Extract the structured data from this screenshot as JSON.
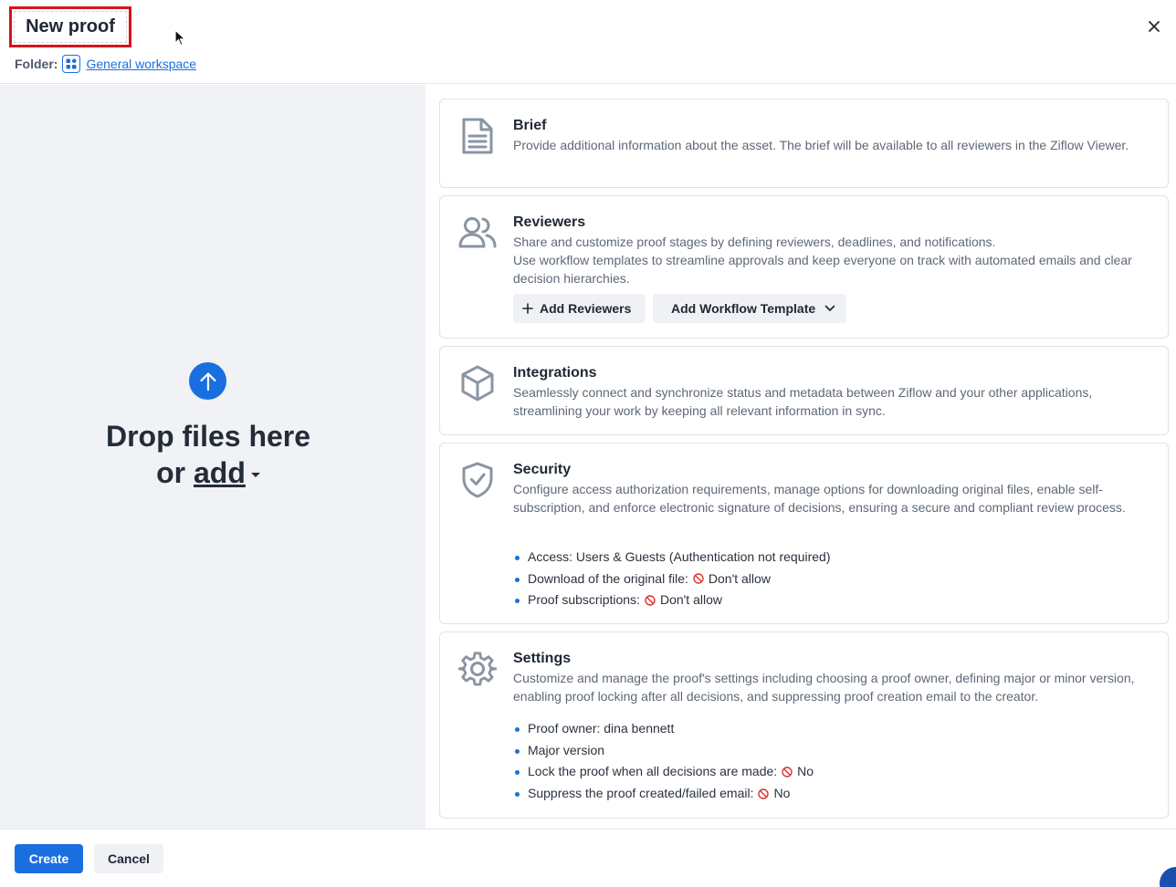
{
  "header": {
    "title": "New proof",
    "folder_label": "Folder:",
    "folder_link": "General workspace",
    "folder_icon": "grid-folder-icon",
    "close_icon": "close-icon"
  },
  "drop_zone": {
    "line1": "Drop files here",
    "line2_prefix": "or ",
    "add_link": "add",
    "upload_icon": "arrow-up-circle-icon"
  },
  "cards": {
    "brief": {
      "title": "Brief",
      "description": "Provide additional information about the asset. The brief will be available to all reviewers in the Ziflow Viewer.",
      "icon": "document-icon"
    },
    "reviewers": {
      "title": "Reviewers",
      "description_1": "Share and customize proof stages by defining reviewers, deadlines, and notifications.",
      "description_2": "Use workflow templates to streamline approvals and keep everyone on track with automated emails and clear decision hierarchies.",
      "add_reviewers_label": "Add Reviewers",
      "add_workflow_label": "Add Workflow Template",
      "icon": "users-icon"
    },
    "integrations": {
      "title": "Integrations",
      "description": "Seamlessly connect and synchronize status and metadata between Ziflow and your other applications, streamlining your work by keeping all relevant information in sync.",
      "icon": "cube-icon"
    },
    "security": {
      "title": "Security",
      "description": "Configure access authorization requirements, manage options for downloading original files, enable self-subscription, and enforce electronic signature of decisions, ensuring a secure and compliant review process.",
      "icon": "shield-check-icon",
      "items": [
        {
          "label": "Access: Users & Guests (Authentication not required)",
          "value": ""
        },
        {
          "label": "Download of the original file:",
          "value": "Don't allow"
        },
        {
          "label": "Proof subscriptions:",
          "value": "Don't allow"
        }
      ]
    },
    "settings": {
      "title": "Settings",
      "description": "Customize and manage the proof's settings including choosing a proof owner, defining major or minor version, enabling proof locking after all decisions, and suppressing proof creation email to the creator.",
      "icon": "gear-icon",
      "items": [
        {
          "label": "Proof owner: dina bennett",
          "value": ""
        },
        {
          "label": "Major version",
          "value": ""
        },
        {
          "label": "Lock the proof when all decisions are made:",
          "value": "No"
        },
        {
          "label": "Suppress the proof created/failed email:",
          "value": "No"
        }
      ]
    }
  },
  "footer": {
    "create_label": "Create",
    "cancel_label": "Cancel"
  },
  "colors": {
    "accent": "#1a6fe0",
    "highlight_box": "#d6131e",
    "deny": "#e0312b"
  }
}
